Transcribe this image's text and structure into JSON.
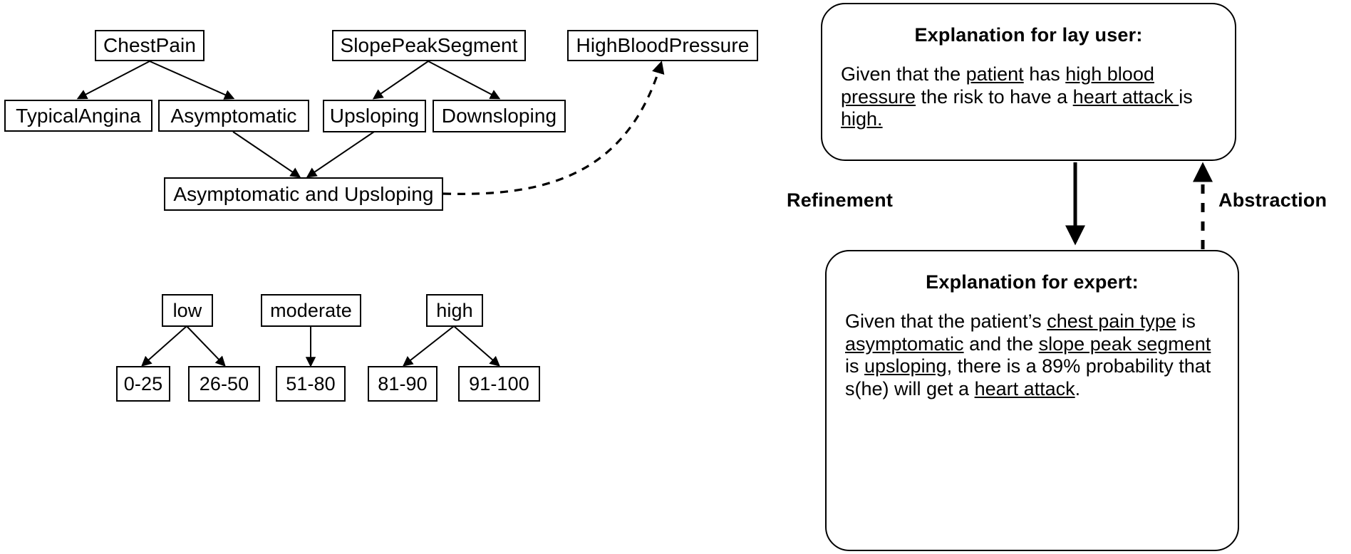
{
  "ontology": {
    "chest_pain_tree": {
      "root": "ChestPain",
      "children": [
        "TypicalAngina",
        "Asymptomatic"
      ]
    },
    "slope_tree": {
      "root": "SlopePeakSegment",
      "children": [
        "Upsloping",
        "Downsloping"
      ]
    },
    "high_blood_pressure": "HighBloodPressure",
    "combined_concept": "Asymptomatic and Upsloping"
  },
  "risk_tree": {
    "groups": [
      {
        "label": "low",
        "ranges": [
          "0-25",
          "26-50"
        ]
      },
      {
        "label": "moderate",
        "ranges": [
          "51-80"
        ]
      },
      {
        "label": "high",
        "ranges": [
          "81-90",
          "91-100"
        ]
      }
    ]
  },
  "panel": {
    "lay": {
      "title": "Explanation for lay user:",
      "text_plain": "Given that the patient has high blood pressure the risk to have a heart attack is high.",
      "segments": [
        {
          "t": "Given that the ",
          "u": false
        },
        {
          "t": "patient",
          "u": true
        },
        {
          "t": " has ",
          "u": false
        },
        {
          "t": "high blood pressure",
          "u": true
        },
        {
          "t": " the risk to have a ",
          "u": false
        },
        {
          "t": "heart attack ",
          "u": true
        },
        {
          "t": "is ",
          "u": false
        },
        {
          "t": "high.",
          "u": true
        }
      ]
    },
    "expert": {
      "title": "Explanation for expert:",
      "text_plain": "Given that the patient’s chest pain type is asymptomatic and the slope peak segment is upsloping, there is a 89% probability that s(he) will get a heart attack.",
      "segments": [
        {
          "t": "Given that the patient’s ",
          "u": false
        },
        {
          "t": "chest pain type",
          "u": true
        },
        {
          "t": " is ",
          "u": false
        },
        {
          "t": "asymptomatic",
          "u": true
        },
        {
          "t": " and the ",
          "u": false
        },
        {
          "t": "slope peak segment ",
          "u": true
        },
        {
          "t": "is ",
          "u": false
        },
        {
          "t": "upsloping",
          "u": true
        },
        {
          "t": ", there is a 89% probability that s(he) will get a ",
          "u": false
        },
        {
          "t": "heart attack",
          "u": true
        },
        {
          "t": ".",
          "u": false
        }
      ],
      "probability": "89%"
    },
    "refinement_label": "Refinement",
    "abstraction_label": "Abstraction"
  },
  "colors": {
    "stroke": "#000000",
    "fill": "#ffffff",
    "text": "#000000"
  }
}
